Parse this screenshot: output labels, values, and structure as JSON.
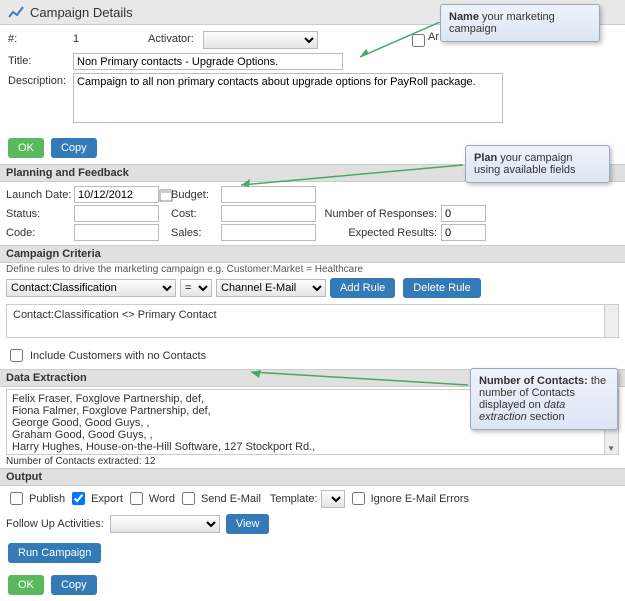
{
  "header": {
    "title": "Campaign Details"
  },
  "form": {
    "num_label": "#:",
    "num_value": "1",
    "activator_label": "Activator:",
    "ar_label": "Ar",
    "title_label": "Title:",
    "title_value": "Non Primary contacts - Upgrade Options.",
    "description_label": "Description:",
    "description_value": "Campaign to all non primary contacts about upgrade options for PayRoll package."
  },
  "buttons": {
    "ok": "OK",
    "copy": "Copy",
    "add_rule": "Add Rule",
    "delete_rule": "Delete Rule",
    "view": "View",
    "run_campaign": "Run Campaign"
  },
  "planning": {
    "header": "Planning and Feedback",
    "launch_date_label": "Launch Date:",
    "launch_date_value": "10/12/2012",
    "budget_label": "Budget:",
    "status_label": "Status:",
    "cost_label": "Cost:",
    "responses_label": "Number of Responses:",
    "responses_value": "0",
    "code_label": "Code:",
    "sales_label": "Sales:",
    "expected_label": "Expected Results:",
    "expected_value": "0"
  },
  "criteria": {
    "header": "Campaign Criteria",
    "hint": "Define rules to drive the marketing campaign e.g. Customer:Market = Healthcare",
    "field": "Contact:Classification",
    "op": "=",
    "channel": "Channel E-Mail",
    "rule_text": "Contact:Classification <> Primary Contact",
    "include_label": "Include Customers with no Contacts"
  },
  "extraction": {
    "header": "Data Extraction",
    "lines": [
      "Felix Fraser, Foxglove Partnership, def,",
      "Fiona Falmer, Foxglove Partnership, def,",
      "George Good, Good Guys, ,",
      "Graham Good, Good Guys, ,",
      "Harry Hughes, House-on-the-Hill Software, 127 Stockport Rd.,"
    ],
    "count_text": "Number of Contacts extracted: 12"
  },
  "output": {
    "header": "Output",
    "publish": "Publish",
    "export": "Export",
    "word": "Word",
    "send_email": "Send E-Mail",
    "template_label": "Template:",
    "ignore_errors": "Ignore E-Mail Errors",
    "followup_label": "Follow Up Activities:"
  },
  "callouts": {
    "c1_bold": "Name",
    "c1_rest": " your marketing campaign",
    "c2_bold": "Plan",
    "c2_rest": " your campaign using available fields",
    "c3_bold": "Number of Contacts:",
    "c3_rest1": " the number of Contacts displayed on ",
    "c3_italic": "data extraction",
    "c3_rest2": " section"
  }
}
